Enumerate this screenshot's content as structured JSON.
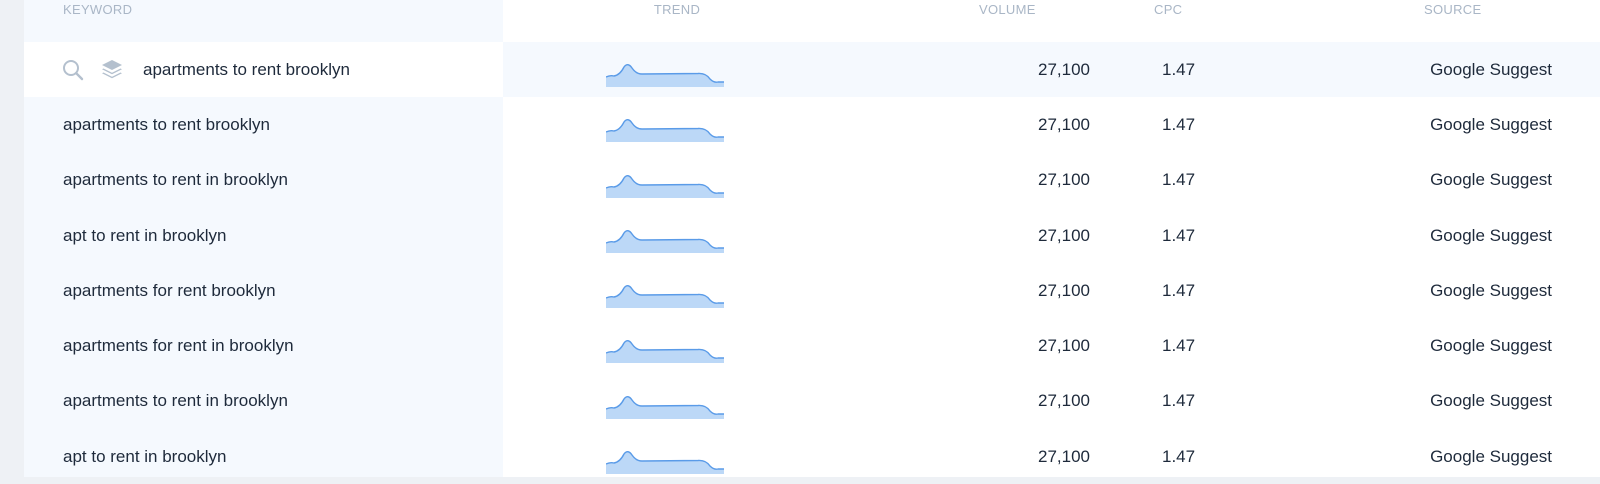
{
  "table": {
    "headers": {
      "keyword": "KEYWORD",
      "trend": "TREND",
      "volume": "VOLUME",
      "cpc": "CPC",
      "source": "SOURCE"
    },
    "rows": [
      {
        "keyword": "apartments to rent brooklyn",
        "volume": "27,100",
        "cpc": "1.47",
        "source": "Google Suggest",
        "active": true
      },
      {
        "keyword": "apartments to rent brooklyn",
        "volume": "27,100",
        "cpc": "1.47",
        "source": "Google Suggest"
      },
      {
        "keyword": "apartments to rent in brooklyn",
        "volume": "27,100",
        "cpc": "1.47",
        "source": "Google Suggest"
      },
      {
        "keyword": "apt to rent in brooklyn",
        "volume": "27,100",
        "cpc": "1.47",
        "source": "Google Suggest"
      },
      {
        "keyword": "apartments for rent brooklyn",
        "volume": "27,100",
        "cpc": "1.47",
        "source": "Google Suggest"
      },
      {
        "keyword": "apartments for rent in brooklyn",
        "volume": "27,100",
        "cpc": "1.47",
        "source": "Google Suggest"
      },
      {
        "keyword": "apartments to rent in brooklyn",
        "volume": "27,100",
        "cpc": "1.47",
        "source": "Google Suggest"
      },
      {
        "keyword": "apt to rent in brooklyn",
        "volume": "27,100",
        "cpc": "1.47",
        "source": "Google Suggest"
      }
    ]
  },
  "icons": {
    "search": "search-icon",
    "layers": "layers-icon",
    "trend": "sparkline-chart"
  },
  "colors": {
    "accent": "#4a90e2",
    "trend_fill": "#bcd8f7",
    "trend_line": "#5a9be8",
    "header_text": "#a9b6c6",
    "keyword_column_bg": "#f5f9fe"
  }
}
